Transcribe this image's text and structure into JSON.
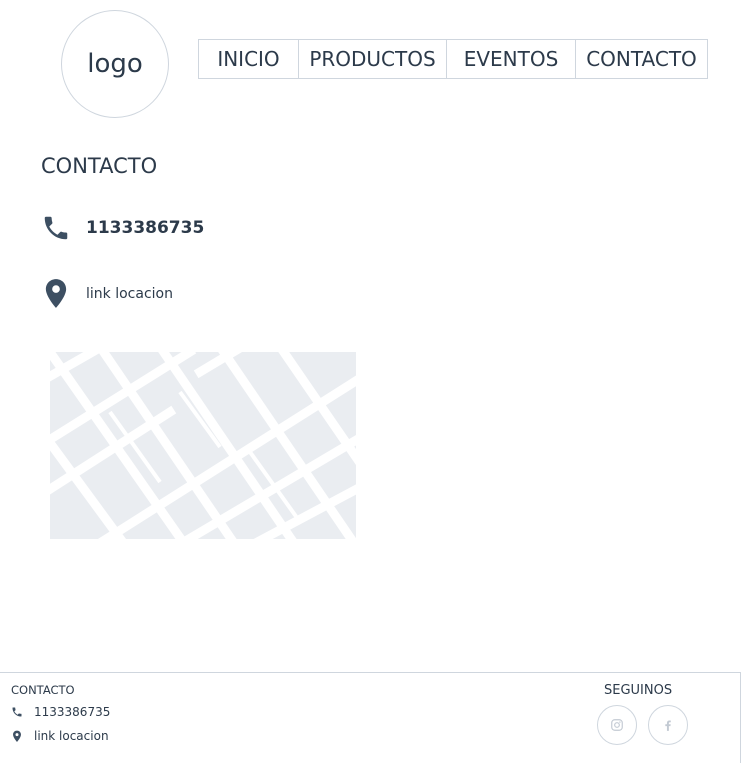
{
  "header": {
    "logo_text": "logo",
    "nav": [
      {
        "label": "INICIO"
      },
      {
        "label": "PRODUCTOS"
      },
      {
        "label": "EVENTOS"
      },
      {
        "label": "CONTACTO"
      }
    ]
  },
  "main": {
    "title": "CONTACTO",
    "phone": "1133386735",
    "location_link": "link locacion"
  },
  "footer": {
    "title": "CONTACTO",
    "phone": "1133386735",
    "location_link": "link locacion",
    "social_title": "SEGUINOS",
    "social_icons": [
      "instagram-icon",
      "facebook-icon"
    ]
  },
  "colors": {
    "text": "#2c3a4a",
    "icon": "#3d4f62",
    "border": "#cfd6de",
    "map_bg": "#eaedf1"
  }
}
